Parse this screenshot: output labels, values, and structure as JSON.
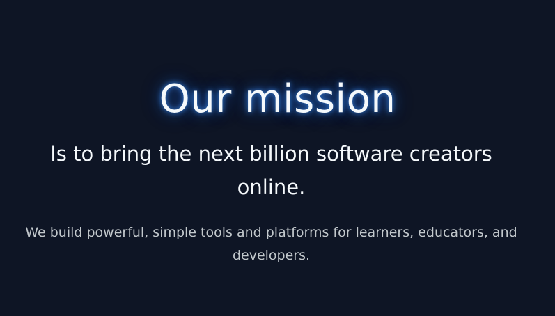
{
  "mission": {
    "title": "Our mission",
    "subtitle": "Is to bring the next billion software creators online.",
    "description": "We build powerful, simple tools and platforms for learners, educators, and developers."
  },
  "colors": {
    "background": "#0e1525",
    "title_text": "#f5f9fc",
    "title_glow": "#4096ff",
    "body_text": "#c2c8cc"
  }
}
